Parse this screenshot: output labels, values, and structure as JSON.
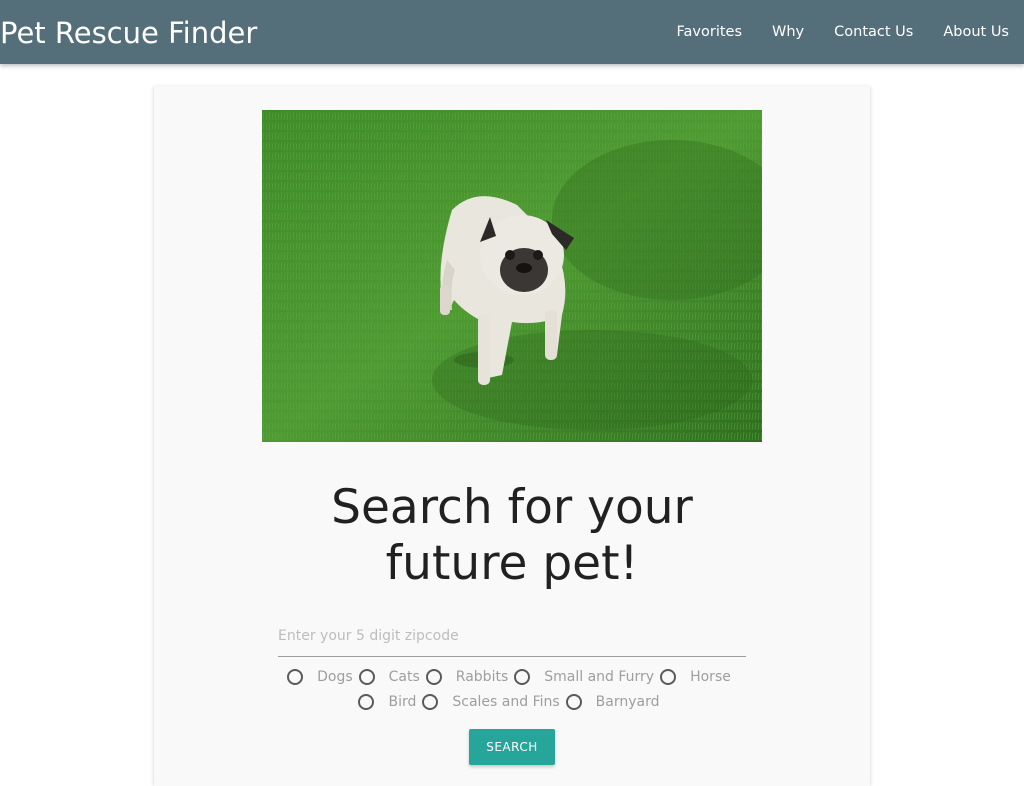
{
  "app": {
    "title": "Pet Rescue Finder"
  },
  "nav": {
    "links": [
      "Favorites",
      "Why",
      "Contact Us",
      "About Us"
    ]
  },
  "hero": {
    "image": "pug-on-grass-photo"
  },
  "main": {
    "heading_line1": "Search for your",
    "heading_line2": "future pet!"
  },
  "search": {
    "zip_placeholder": "Enter your 5 digit zipcode",
    "zip_value": "",
    "animal_types": [
      "Dogs",
      "Cats",
      "Rabbits",
      "Small and Furry",
      "Horse",
      "Bird",
      "Scales and Fins",
      "Barnyard"
    ],
    "selected": null,
    "button_label": "SEARCH"
  },
  "colors": {
    "navbar": "#546e7a",
    "accent": "#26a69a",
    "card_bg": "#f9f9f9"
  }
}
